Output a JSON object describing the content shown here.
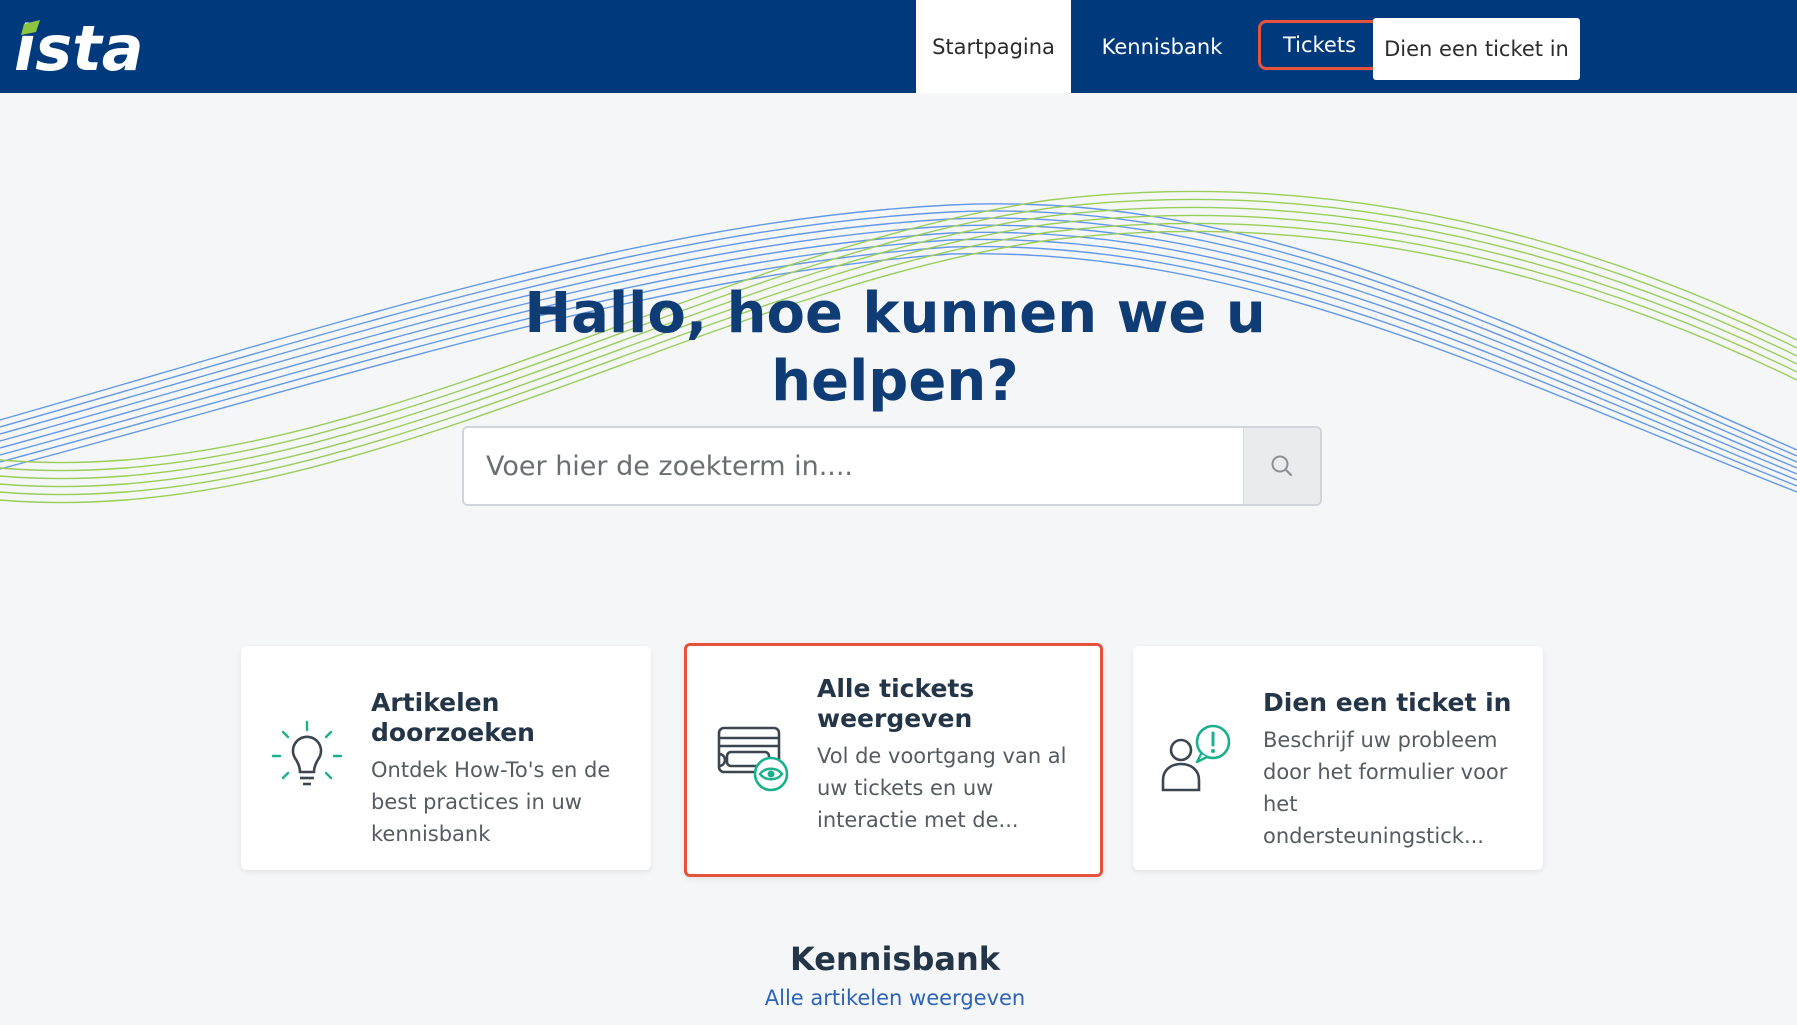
{
  "header": {
    "logo_text": "ista",
    "nav": {
      "home": "Startpagina",
      "knowledge_base": "Kennisbank",
      "tickets": "Tickets"
    },
    "submit_ticket_label": "Dien een ticket in"
  },
  "hero": {
    "title": "Hallo, hoe kunnen we u helpen?",
    "search_placeholder": "Voer hier de zoekterm in...."
  },
  "cards": [
    {
      "title": "Artikelen doorzoeken",
      "description": "Ontdek How-To's en de best practices in uw kennisbank",
      "icon": "lightbulb-icon"
    },
    {
      "title": "Alle tickets weergeven",
      "description": "Vol de voortgang van al uw tickets en uw interactie met de...",
      "icon": "ticket-view-icon"
    },
    {
      "title": "Dien een ticket in",
      "description": "Beschrijf uw probleem door het formulier voor het ondersteuningstick...",
      "icon": "user-alert-icon"
    }
  ],
  "knowledge_base": {
    "heading": "Kennisbank",
    "link": "Alle artikelen weergeven"
  },
  "colors": {
    "header_bg": "#003a7d",
    "title": "#0f3c75",
    "highlight": "#e5533d",
    "link": "#2d63b8",
    "accent_green": "#1bb08d"
  }
}
